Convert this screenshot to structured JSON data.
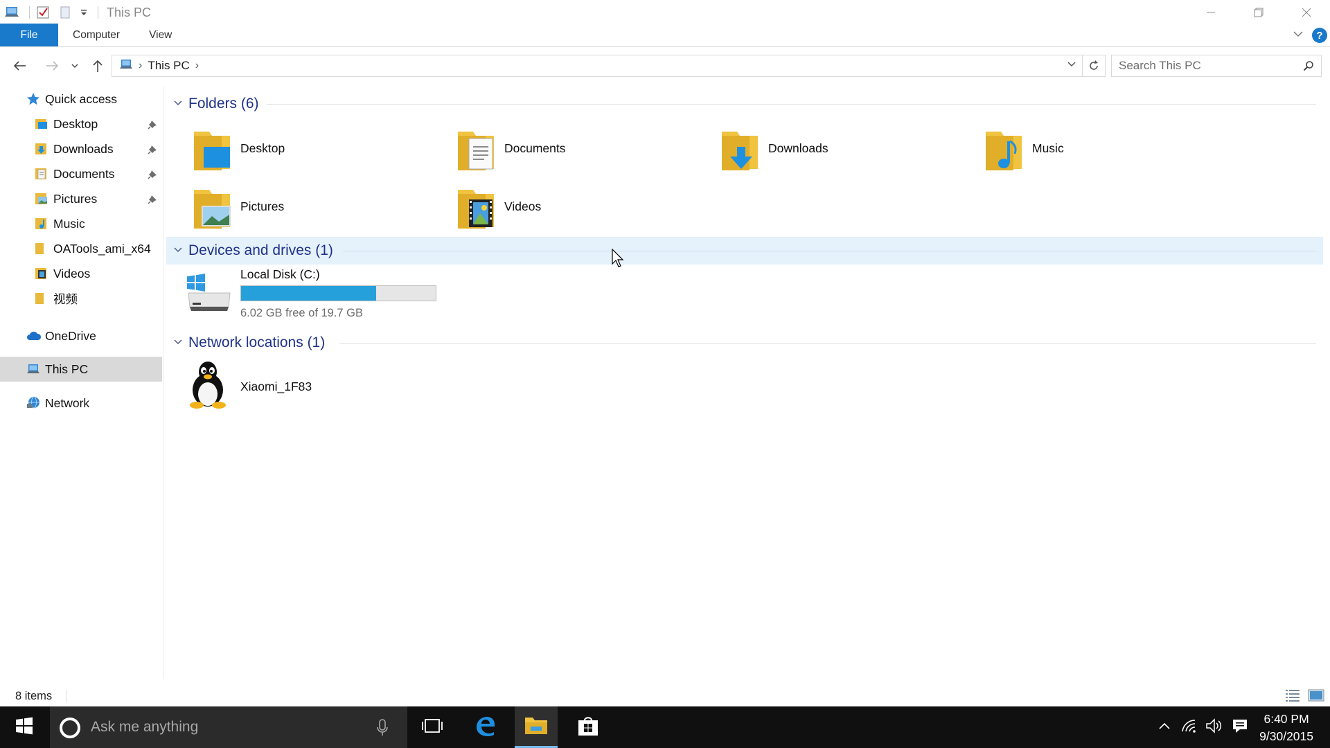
{
  "window": {
    "title": "This PC",
    "quick_access_toolbar": [
      "properties-icon",
      "new-folder-icon",
      "customize-dropdown"
    ]
  },
  "ribbon": {
    "tabs": [
      {
        "label": "File",
        "active": true
      },
      {
        "label": "Computer"
      },
      {
        "label": "View"
      }
    ],
    "help_label": "?"
  },
  "address": {
    "breadcrumb": [
      "This PC"
    ],
    "search_placeholder": "Search This PC"
  },
  "nav": {
    "quick_access": "Quick access",
    "pinned": [
      {
        "label": "Desktop",
        "icon": "desktop-folder-icon",
        "pinned": true
      },
      {
        "label": "Downloads",
        "icon": "downloads-folder-icon",
        "pinned": true
      },
      {
        "label": "Documents",
        "icon": "documents-folder-icon",
        "pinned": true
      },
      {
        "label": "Pictures",
        "icon": "pictures-folder-icon",
        "pinned": true
      },
      {
        "label": "Music",
        "icon": "music-folder-icon",
        "pinned": false
      },
      {
        "label": "OATools_ami_x64",
        "icon": "folder-icon",
        "pinned": false
      },
      {
        "label": "Videos",
        "icon": "videos-folder-icon",
        "pinned": false
      },
      {
        "label": "视频",
        "icon": "folder-icon",
        "pinned": false
      }
    ],
    "onedrive": "OneDrive",
    "this_pc": "This PC",
    "network": "Network"
  },
  "content": {
    "folders_header": "Folders (6)",
    "folders": [
      {
        "label": "Desktop",
        "icon": "desktop-folder-icon"
      },
      {
        "label": "Documents",
        "icon": "documents-folder-icon"
      },
      {
        "label": "Downloads",
        "icon": "downloads-folder-icon"
      },
      {
        "label": "Music",
        "icon": "music-folder-icon"
      },
      {
        "label": "Pictures",
        "icon": "pictures-folder-icon"
      },
      {
        "label": "Videos",
        "icon": "videos-folder-icon"
      }
    ],
    "devices_header": "Devices and drives (1)",
    "drive": {
      "name": "Local Disk (C:)",
      "free_text": "6.02 GB free of 19.7 GB",
      "used_fraction": 0.694,
      "bar_color": "#26a0da"
    },
    "network_header": "Network locations (1)",
    "network_location": {
      "label": "Xiaomi_1F83",
      "icon": "linux-penguin-icon"
    }
  },
  "status": {
    "item_count": "8 items"
  },
  "taskbar": {
    "search_placeholder": "Ask me anything",
    "time": "6:40 PM",
    "date": "9/30/2015",
    "accent": "#76b9ed"
  }
}
